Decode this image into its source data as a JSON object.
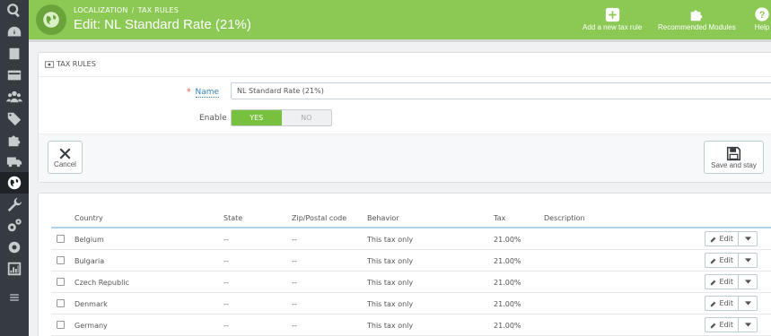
{
  "header": {
    "breadcrumb": [
      "LOCALIZATION",
      "TAX RULES"
    ],
    "breadcrumb_sep": "/",
    "title": "Edit: NL Standard Rate (21%)",
    "toolbar": {
      "add_label": "Add a new tax rule",
      "recommended_label": "Recommended Modules",
      "help_label": "Help"
    }
  },
  "sidebar": {
    "items": [
      "search-icon",
      "dashboard-icon",
      "orders-icon",
      "payment-icon",
      "customers-icon",
      "catalog-icon",
      "modules-icon",
      "shipping-icon",
      "localization-icon",
      "tools-icon",
      "advanced-icon",
      "preferences-icon",
      "stats-icon",
      "menu-icon"
    ]
  },
  "form": {
    "section_title": "TAX RULES",
    "required_mark": "*",
    "name_label": "Name",
    "name_value": "NL Standard Rate (21%)",
    "enable_label": "Enable",
    "enable_yes": "YES",
    "enable_no": "NO",
    "enabled": true,
    "cancel_label": "Cancel",
    "save_label": "Save and stay"
  },
  "table": {
    "columns": [
      "Country",
      "State",
      "Zip/Postal code",
      "Behavior",
      "Tax",
      "Description"
    ],
    "edit_label": "Edit",
    "rows": [
      {
        "country": "Belgium",
        "state": "--",
        "zip": "--",
        "behavior": "This tax only",
        "tax": "21.00%",
        "description": ""
      },
      {
        "country": "Bulgaria",
        "state": "--",
        "zip": "--",
        "behavior": "This tax only",
        "tax": "21.00%",
        "description": ""
      },
      {
        "country": "Czech Republic",
        "state": "--",
        "zip": "--",
        "behavior": "This tax only",
        "tax": "21.00%",
        "description": ""
      },
      {
        "country": "Denmark",
        "state": "--",
        "zip": "--",
        "behavior": "This tax only",
        "tax": "21.00%",
        "description": ""
      },
      {
        "country": "Germany",
        "state": "--",
        "zip": "--",
        "behavior": "This tax only",
        "tax": "21.00%",
        "description": ""
      }
    ]
  },
  "colors": {
    "header": "#8bc954",
    "sidebar": "#363a41",
    "toggle_on": "#78c13e",
    "link": "#3a86c7"
  }
}
